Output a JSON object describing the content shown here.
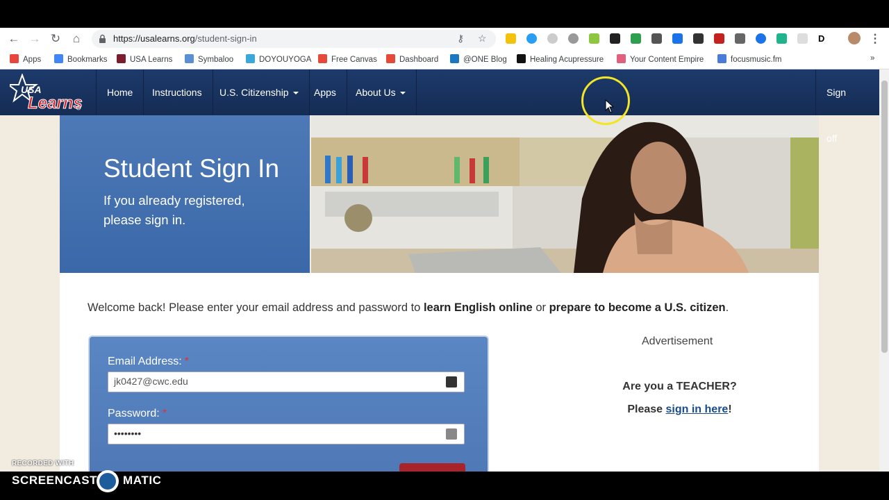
{
  "browser": {
    "url_host": "https://usalearns.org",
    "url_path": "/student-sign-in",
    "bookmarks": [
      {
        "label": "Apps",
        "color": "#e8453c"
      },
      {
        "label": "Bookmarks",
        "color": "#4285f4"
      },
      {
        "label": "USA Learns",
        "color": "#7b1d2c"
      },
      {
        "label": "Symbaloo",
        "color": "#5b8fd4"
      },
      {
        "label": "DOYOUYOGA",
        "color": "#3aa8d8"
      },
      {
        "label": "Free Canvas",
        "color": "#e4493a"
      },
      {
        "label": "Dashboard",
        "color": "#e4493a"
      },
      {
        "label": "@ONE Blog",
        "color": "#1c77c3"
      },
      {
        "label": "Healing Acupressure",
        "color": "#111111"
      },
      {
        "label": "Your Content Empire",
        "color": "#e0607e"
      },
      {
        "label": "focusmusic.fm",
        "color": "#4a7bd8"
      }
    ],
    "more_label": "»"
  },
  "site": {
    "nav": [
      {
        "label": "Home"
      },
      {
        "label": "Instructions"
      },
      {
        "label": "U.S. Citizenship"
      },
      {
        "label": "Apps"
      },
      {
        "label": "About Us"
      }
    ],
    "signoff": "Sign off",
    "logo_text": "USA Learns"
  },
  "hero": {
    "title": "Student Sign In",
    "subtitle": "If you already registered, please sign in."
  },
  "welcome": {
    "pre": "Welcome back! Please enter your email address and password to ",
    "bold1": "learn English online",
    "mid": " or ",
    "bold2": "prepare to become a U.S. citizen",
    "post": "."
  },
  "form": {
    "email_label": "Email Address:",
    "email_value": "jk0427@cwc.edu",
    "password_label": "Password:",
    "password_value": "••••••••",
    "required_mark": "*"
  },
  "sidebar": {
    "ad_label": "Advertisement",
    "teacher_q": "Are you a TEACHER?",
    "please": "Please ",
    "link": "sign in here",
    "bang": "!"
  },
  "watermark": {
    "recorded_with": "RECORDED WITH",
    "brand_left": "SCREENCAST",
    "brand_right": "MATIC"
  }
}
